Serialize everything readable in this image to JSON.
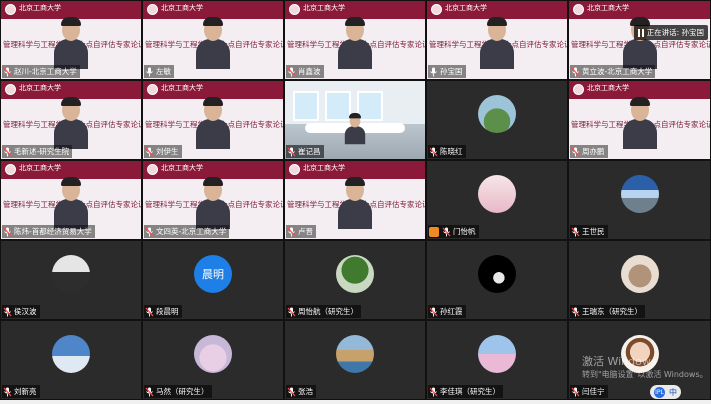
{
  "app": {
    "banner_school": "北京工商大学",
    "meeting_title": "管理科学与工程学科博士点自评估专家论证会",
    "speaking_label": "正在讲话: 孙宝国",
    "ime_mode": "中",
    "ime_badge": "IPL",
    "windows_watermark_line1": "激活 Windows",
    "windows_watermark_line2": "转到\"电脑设置\"以激活 Windows。"
  },
  "participants": [
    {
      "name": "赵川-北京工商大学",
      "kind": "video",
      "muted": true
    },
    {
      "name": "左敏",
      "kind": "video",
      "muted": false
    },
    {
      "name": "肖鑫波",
      "kind": "video",
      "muted": true
    },
    {
      "name": "孙宝国",
      "kind": "video",
      "muted": false,
      "speaking": true
    },
    {
      "name": "黄立波-北京工商大学",
      "kind": "video",
      "muted": true
    },
    {
      "name": "毛新述-研究生院",
      "kind": "video",
      "muted": true
    },
    {
      "name": "刘伊生",
      "kind": "video",
      "muted": true
    },
    {
      "name": "崔记昌",
      "kind": "room",
      "muted": true
    },
    {
      "name": "陈晓红",
      "kind": "avatar",
      "muted": true,
      "avatar": "landscape-green"
    },
    {
      "name": "周亦鹏",
      "kind": "video",
      "muted": true
    },
    {
      "name": "陈炜-首都经济贸易大学",
      "kind": "video",
      "muted": true
    },
    {
      "name": "文四英-北京工商大学",
      "kind": "video",
      "muted": true
    },
    {
      "name": "卢晋",
      "kind": "video",
      "muted": true
    },
    {
      "name": "门怡帆",
      "kind": "avatar",
      "muted": true,
      "avatar": "pink-figure",
      "orange_icon": true
    },
    {
      "name": "王世民",
      "kind": "avatar",
      "muted": true,
      "avatar": "mountain-sky"
    },
    {
      "name": "侯汉波",
      "kind": "avatar",
      "muted": true,
      "avatar": "building"
    },
    {
      "name": "段晨明",
      "kind": "avatar-text",
      "muted": true,
      "avatar_text": "晨明"
    },
    {
      "name": "周怡航（研究生）",
      "kind": "avatar",
      "muted": true,
      "avatar": "tree-figure"
    },
    {
      "name": "孙红霞",
      "kind": "avatar",
      "muted": true,
      "avatar": "dark-hand"
    },
    {
      "name": "王瑞东（研究生）",
      "kind": "avatar",
      "muted": true,
      "avatar": "cat"
    },
    {
      "name": "刘新亮",
      "kind": "avatar",
      "muted": true,
      "avatar": "sky-clouds"
    },
    {
      "name": "马然（研究生）",
      "kind": "avatar",
      "muted": true,
      "avatar": "bunny"
    },
    {
      "name": "张浩",
      "kind": "avatar",
      "muted": true,
      "avatar": "coast"
    },
    {
      "name": "李佳琪（研究生）",
      "kind": "avatar",
      "muted": true,
      "avatar": "girl-sky"
    },
    {
      "name": "闫佳宁",
      "kind": "avatar",
      "muted": true,
      "avatar": "child"
    }
  ],
  "colors": {
    "banner": "#8b1a3a",
    "tile_dark": "#2b2b2b",
    "avatar_text_bg": "#1e7fe6"
  }
}
